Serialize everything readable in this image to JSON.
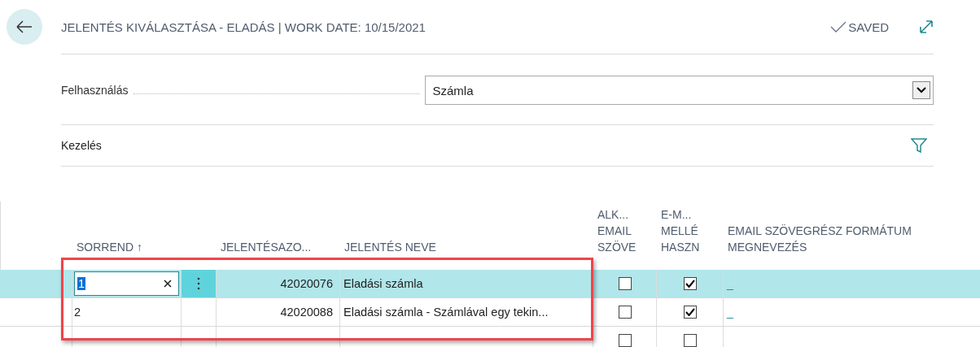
{
  "header": {
    "title": "JELENTÉS KIVÁLASZTÁSA - ELADÁS | WORK DATE: 10/15/2021",
    "status": "SAVED"
  },
  "fields": [
    {
      "label": "Felhasználás",
      "value": "Számla"
    }
  ],
  "section": {
    "title": "Kezelés"
  },
  "table": {
    "columns": [
      {
        "label": "SORREND ↑"
      },
      {
        "label": "JELENTÉSAZO..."
      },
      {
        "label": "JELENTÉS NEVE"
      },
      {
        "label": "ALK...\nEMAIL\nSZÖVE"
      },
      {
        "label": "E-M...\nMELLÉ\nHASZN"
      },
      {
        "label": "EMAIL SZÖVEGRÉSZ FORMÁTUM\nMEGNEVEZÉS"
      }
    ],
    "rows": [
      {
        "order": "1",
        "editing": true,
        "selected": true,
        "report_id": "42020076",
        "report_name": "Eladási számla",
        "alk_checked": false,
        "em_checked": true,
        "format": "_"
      },
      {
        "order": "2",
        "editing": false,
        "selected": false,
        "report_id": "42020088",
        "report_name": "Eladási számla - Számlával egy tekin...",
        "alk_checked": false,
        "em_checked": true,
        "format": "_"
      },
      {
        "editing": false,
        "selected": false,
        "alk_checked": false,
        "em_checked": false
      }
    ]
  },
  "annotation": {
    "kind": "rectangle",
    "color": "#f0444a"
  }
}
